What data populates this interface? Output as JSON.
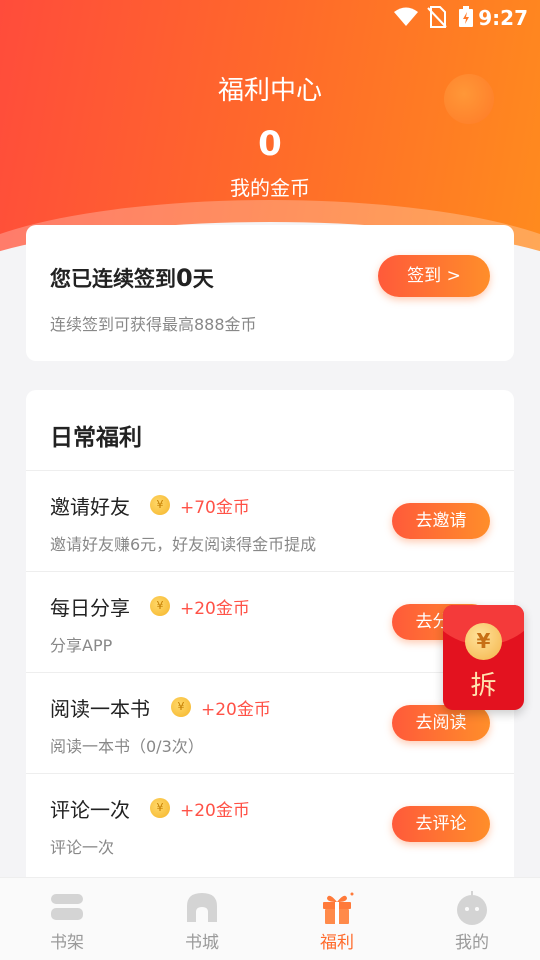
{
  "status_bar": {
    "time": "9:27"
  },
  "header": {
    "title": "福利中心",
    "coin_count": "0",
    "coin_label": "我的金币"
  },
  "signin": {
    "prefix": "您已连续签到",
    "days": "0",
    "suffix": "天",
    "subtitle": "连续签到可获得最高888金币",
    "button_label": "签到 >"
  },
  "daily": {
    "title": "日常福利",
    "tasks": [
      {
        "name": "邀请好友",
        "reward": "+70金币",
        "desc": "邀请好友赚6元，好友阅读得金币提成",
        "button": "去邀请"
      },
      {
        "name": "每日分享",
        "reward": "+20金币",
        "desc": "分享APP",
        "button": "去分享"
      },
      {
        "name": "阅读一本书",
        "reward": "+20金币",
        "desc": "阅读一本书（0/3次）",
        "button": "去阅读"
      },
      {
        "name": "评论一次",
        "reward": "+20金币",
        "desc": "评论一次",
        "button": "去评论"
      }
    ]
  },
  "red_packet": {
    "symbol": "¥",
    "label": "拆"
  },
  "tabs": [
    {
      "label": "书架",
      "icon": "bookshelf-icon"
    },
    {
      "label": "书城",
      "icon": "bookstore-icon"
    },
    {
      "label": "福利",
      "icon": "gift-icon",
      "active": true
    },
    {
      "label": "我的",
      "icon": "profile-icon"
    }
  ],
  "colors": {
    "accent": "#ff6a2a",
    "reward_red": "#ff5247",
    "red_packet": "#e3121f"
  }
}
